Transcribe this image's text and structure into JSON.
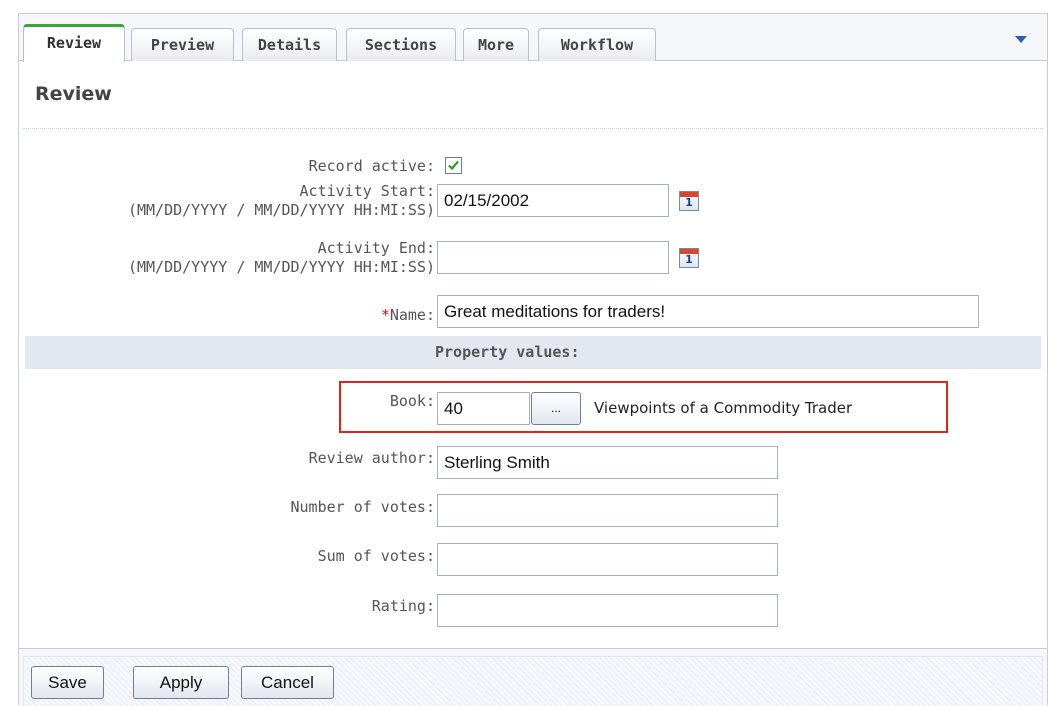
{
  "tabs": [
    {
      "label": "Review"
    },
    {
      "label": "Preview"
    },
    {
      "label": "Details"
    },
    {
      "label": "Sections"
    },
    {
      "label": "More"
    },
    {
      "label": "Workflow"
    }
  ],
  "active_tab": "Review",
  "panel": {
    "title": "Review"
  },
  "fields": {
    "record_active": {
      "label": "Record active:",
      "checked": true
    },
    "activity_start": {
      "label": "Activity Start:",
      "hint": "(MM/DD/YYYY / MM/DD/YYYY HH:MI:SS)",
      "value": "02/15/2002",
      "calendar_icon_text": "1"
    },
    "activity_end": {
      "label": "Activity End:",
      "hint": "(MM/DD/YYYY / MM/DD/YYYY HH:MI:SS)",
      "value": "",
      "calendar_icon_text": "1"
    },
    "name": {
      "required_mark": "*",
      "label": "Name:",
      "value": "Great meditations for traders!"
    }
  },
  "property_values": {
    "heading": "Property values:",
    "book": {
      "label": "Book:",
      "value": "40",
      "browse_label": "...",
      "book_title": "Viewpoints of a Commodity Trader"
    },
    "review_author": {
      "label": "Review author:",
      "value": "Sterling Smith"
    },
    "number_of_votes": {
      "label": "Number of votes:",
      "value": ""
    },
    "sum_of_votes": {
      "label": "Sum of votes:",
      "value": ""
    },
    "rating": {
      "label": "Rating:",
      "value": ""
    }
  },
  "footer": {
    "save_label": "Save",
    "apply_label": "Apply",
    "cancel_label": "Cancel"
  },
  "colors": {
    "active_tab_accent": "#3da43d",
    "required_mark": "#d01010",
    "highlight_border": "#e2231a",
    "section_band": "#e3e8f0",
    "menu_arrow": "#2a5fb0"
  },
  "icons": [
    "checkbox-checked-icon",
    "calendar-icon",
    "chevron-down-icon"
  ]
}
